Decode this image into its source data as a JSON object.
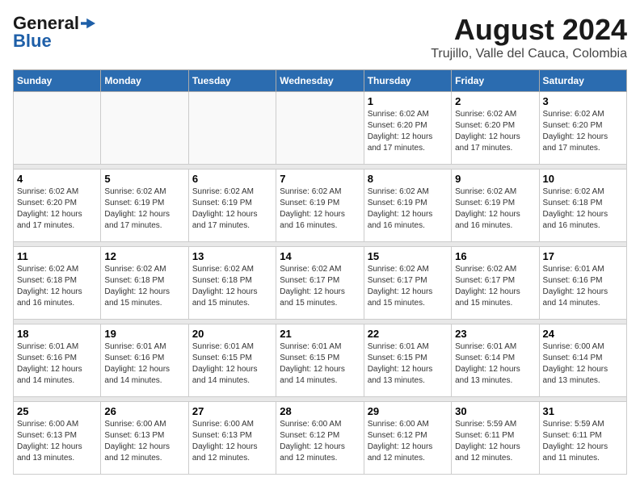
{
  "logo": {
    "text_general": "General",
    "text_blue": "Blue",
    "arrow_color": "#1e5fa8"
  },
  "header": {
    "title": "August 2024",
    "subtitle": "Trujillo, Valle del Cauca, Colombia"
  },
  "weekdays": [
    "Sunday",
    "Monday",
    "Tuesday",
    "Wednesday",
    "Thursday",
    "Friday",
    "Saturday"
  ],
  "weeks": [
    {
      "days": [
        {
          "number": "",
          "info": ""
        },
        {
          "number": "",
          "info": ""
        },
        {
          "number": "",
          "info": ""
        },
        {
          "number": "",
          "info": ""
        },
        {
          "number": "1",
          "info": "Sunrise: 6:02 AM\nSunset: 6:20 PM\nDaylight: 12 hours\nand 17 minutes."
        },
        {
          "number": "2",
          "info": "Sunrise: 6:02 AM\nSunset: 6:20 PM\nDaylight: 12 hours\nand 17 minutes."
        },
        {
          "number": "3",
          "info": "Sunrise: 6:02 AM\nSunset: 6:20 PM\nDaylight: 12 hours\nand 17 minutes."
        }
      ]
    },
    {
      "days": [
        {
          "number": "4",
          "info": "Sunrise: 6:02 AM\nSunset: 6:20 PM\nDaylight: 12 hours\nand 17 minutes."
        },
        {
          "number": "5",
          "info": "Sunrise: 6:02 AM\nSunset: 6:19 PM\nDaylight: 12 hours\nand 17 minutes."
        },
        {
          "number": "6",
          "info": "Sunrise: 6:02 AM\nSunset: 6:19 PM\nDaylight: 12 hours\nand 17 minutes."
        },
        {
          "number": "7",
          "info": "Sunrise: 6:02 AM\nSunset: 6:19 PM\nDaylight: 12 hours\nand 16 minutes."
        },
        {
          "number": "8",
          "info": "Sunrise: 6:02 AM\nSunset: 6:19 PM\nDaylight: 12 hours\nand 16 minutes."
        },
        {
          "number": "9",
          "info": "Sunrise: 6:02 AM\nSunset: 6:19 PM\nDaylight: 12 hours\nand 16 minutes."
        },
        {
          "number": "10",
          "info": "Sunrise: 6:02 AM\nSunset: 6:18 PM\nDaylight: 12 hours\nand 16 minutes."
        }
      ]
    },
    {
      "days": [
        {
          "number": "11",
          "info": "Sunrise: 6:02 AM\nSunset: 6:18 PM\nDaylight: 12 hours\nand 16 minutes."
        },
        {
          "number": "12",
          "info": "Sunrise: 6:02 AM\nSunset: 6:18 PM\nDaylight: 12 hours\nand 15 minutes."
        },
        {
          "number": "13",
          "info": "Sunrise: 6:02 AM\nSunset: 6:18 PM\nDaylight: 12 hours\nand 15 minutes."
        },
        {
          "number": "14",
          "info": "Sunrise: 6:02 AM\nSunset: 6:17 PM\nDaylight: 12 hours\nand 15 minutes."
        },
        {
          "number": "15",
          "info": "Sunrise: 6:02 AM\nSunset: 6:17 PM\nDaylight: 12 hours\nand 15 minutes."
        },
        {
          "number": "16",
          "info": "Sunrise: 6:02 AM\nSunset: 6:17 PM\nDaylight: 12 hours\nand 15 minutes."
        },
        {
          "number": "17",
          "info": "Sunrise: 6:01 AM\nSunset: 6:16 PM\nDaylight: 12 hours\nand 14 minutes."
        }
      ]
    },
    {
      "days": [
        {
          "number": "18",
          "info": "Sunrise: 6:01 AM\nSunset: 6:16 PM\nDaylight: 12 hours\nand 14 minutes."
        },
        {
          "number": "19",
          "info": "Sunrise: 6:01 AM\nSunset: 6:16 PM\nDaylight: 12 hours\nand 14 minutes."
        },
        {
          "number": "20",
          "info": "Sunrise: 6:01 AM\nSunset: 6:15 PM\nDaylight: 12 hours\nand 14 minutes."
        },
        {
          "number": "21",
          "info": "Sunrise: 6:01 AM\nSunset: 6:15 PM\nDaylight: 12 hours\nand 14 minutes."
        },
        {
          "number": "22",
          "info": "Sunrise: 6:01 AM\nSunset: 6:15 PM\nDaylight: 12 hours\nand 13 minutes."
        },
        {
          "number": "23",
          "info": "Sunrise: 6:01 AM\nSunset: 6:14 PM\nDaylight: 12 hours\nand 13 minutes."
        },
        {
          "number": "24",
          "info": "Sunrise: 6:00 AM\nSunset: 6:14 PM\nDaylight: 12 hours\nand 13 minutes."
        }
      ]
    },
    {
      "days": [
        {
          "number": "25",
          "info": "Sunrise: 6:00 AM\nSunset: 6:13 PM\nDaylight: 12 hours\nand 13 minutes."
        },
        {
          "number": "26",
          "info": "Sunrise: 6:00 AM\nSunset: 6:13 PM\nDaylight: 12 hours\nand 12 minutes."
        },
        {
          "number": "27",
          "info": "Sunrise: 6:00 AM\nSunset: 6:13 PM\nDaylight: 12 hours\nand 12 minutes."
        },
        {
          "number": "28",
          "info": "Sunrise: 6:00 AM\nSunset: 6:12 PM\nDaylight: 12 hours\nand 12 minutes."
        },
        {
          "number": "29",
          "info": "Sunrise: 6:00 AM\nSunset: 6:12 PM\nDaylight: 12 hours\nand 12 minutes."
        },
        {
          "number": "30",
          "info": "Sunrise: 5:59 AM\nSunset: 6:11 PM\nDaylight: 12 hours\nand 12 minutes."
        },
        {
          "number": "31",
          "info": "Sunrise: 5:59 AM\nSunset: 6:11 PM\nDaylight: 12 hours\nand 11 minutes."
        }
      ]
    }
  ]
}
